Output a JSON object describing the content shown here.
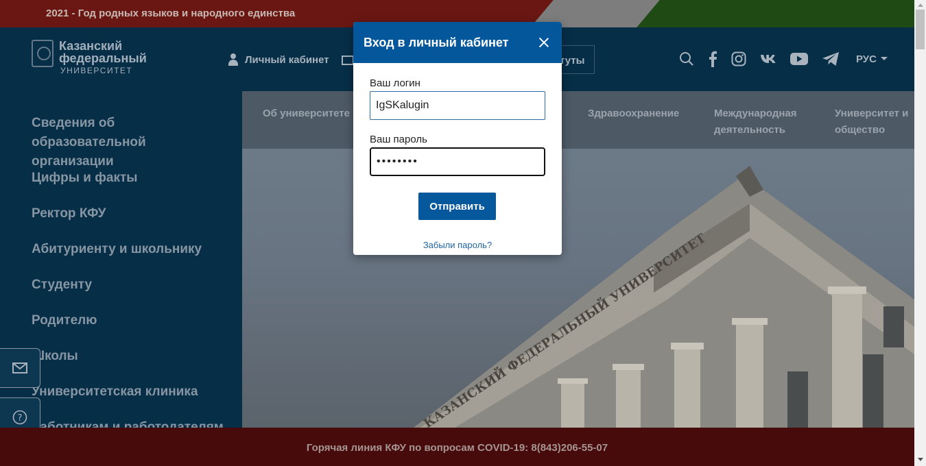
{
  "banner": {
    "text": "2021 - Год родных языков и народного единства"
  },
  "logo": {
    "line1": "Казанский",
    "line2": "федеральный",
    "line3": "УНИВЕРСИТЕТ"
  },
  "header": {
    "account_label": "Личный кабинет",
    "button_partial_label": "туты",
    "icons": [
      "search-icon",
      "facebook-icon",
      "instagram-icon",
      "vk-icon",
      "youtube-icon",
      "telegram-icon"
    ],
    "language": "РУС"
  },
  "sidebar": {
    "items": [
      {
        "label": "Сведения об образовательной организации"
      },
      {
        "label": "Цифры и факты"
      },
      {
        "label": "Ректор КФУ"
      },
      {
        "label": "Абитуриенту и школьнику"
      },
      {
        "label": "Студенту"
      },
      {
        "label": "Родителю"
      },
      {
        "label": "Школы"
      },
      {
        "label": "Университетская клиника"
      },
      {
        "label": "Работникам и работодателям"
      }
    ]
  },
  "topnav": {
    "items": [
      {
        "label": "Об университете"
      },
      {
        "label": "Здравоохранение"
      },
      {
        "label": "Международная деятельность"
      },
      {
        "label": "Университет и общество"
      }
    ]
  },
  "hero": {
    "inscription": "КАЗАНСКИЙ ФЕДЕРАЛЬНЫЙ УНИВЕРСИТЕТ"
  },
  "hotline": {
    "text": "Горячая линия КФУ по вопросам COVID-19: 8(843)206-55-07"
  },
  "modal": {
    "title": "Вход в личный кабинет",
    "login_label": "Ваш логин",
    "login_value": "IgSKalugin",
    "password_label": "Ваш пароль",
    "password_value": "••••••••",
    "submit_label": "Отправить",
    "forgot_label": "Забыли пароль?"
  },
  "colors": {
    "modal_header": "#04579b",
    "submit": "#06589d",
    "header_dim": "#062e47",
    "banner": "#6a1713"
  }
}
